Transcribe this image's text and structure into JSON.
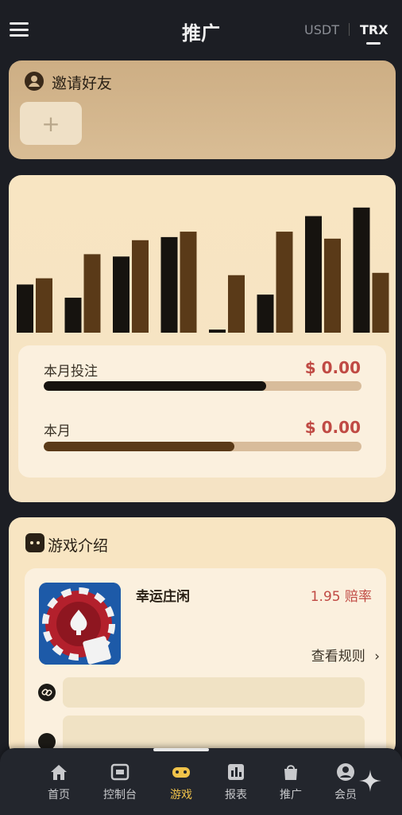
{
  "header": {
    "title": "推广",
    "currency_usdt": "USDT",
    "currency_trx": "TRX"
  },
  "invite": {
    "title": "邀请好友",
    "add_label": "+"
  },
  "stats": {
    "chart_data": {
      "type": "bar",
      "series": [
        {
          "color": "#16130f",
          "values": [
            62,
            45,
            98,
            123,
            4,
            49,
            150,
            161
          ]
        },
        {
          "color": "#5a3a18",
          "values": [
            70,
            101,
            119,
            130,
            74,
            130,
            121,
            77
          ]
        }
      ],
      "ylim": [
        0,
        170
      ]
    },
    "bet_label": "本月投注",
    "bet_value": "$ 0.00",
    "bet_progress": 0.7,
    "second_label": "本月",
    "second_value": "$ 0.00",
    "second_progress": 0.6,
    "colors": {
      "bet_fill": "#16130f",
      "second_fill": "#5a3a18"
    }
  },
  "game": {
    "section_title": "游戏介绍",
    "name": "幸运庄闲",
    "rate": "1.95 赔率",
    "rules_label": "查看规则"
  },
  "tabbar": {
    "items": [
      {
        "label": "首页",
        "icon": "home-icon"
      },
      {
        "label": "控制台",
        "icon": "console-icon"
      },
      {
        "label": "游戏",
        "icon": "game-icon"
      },
      {
        "label": "报表",
        "icon": "report-icon"
      },
      {
        "label": "推广",
        "icon": "bag-icon"
      },
      {
        "label": "会员",
        "icon": "user-icon"
      }
    ]
  }
}
